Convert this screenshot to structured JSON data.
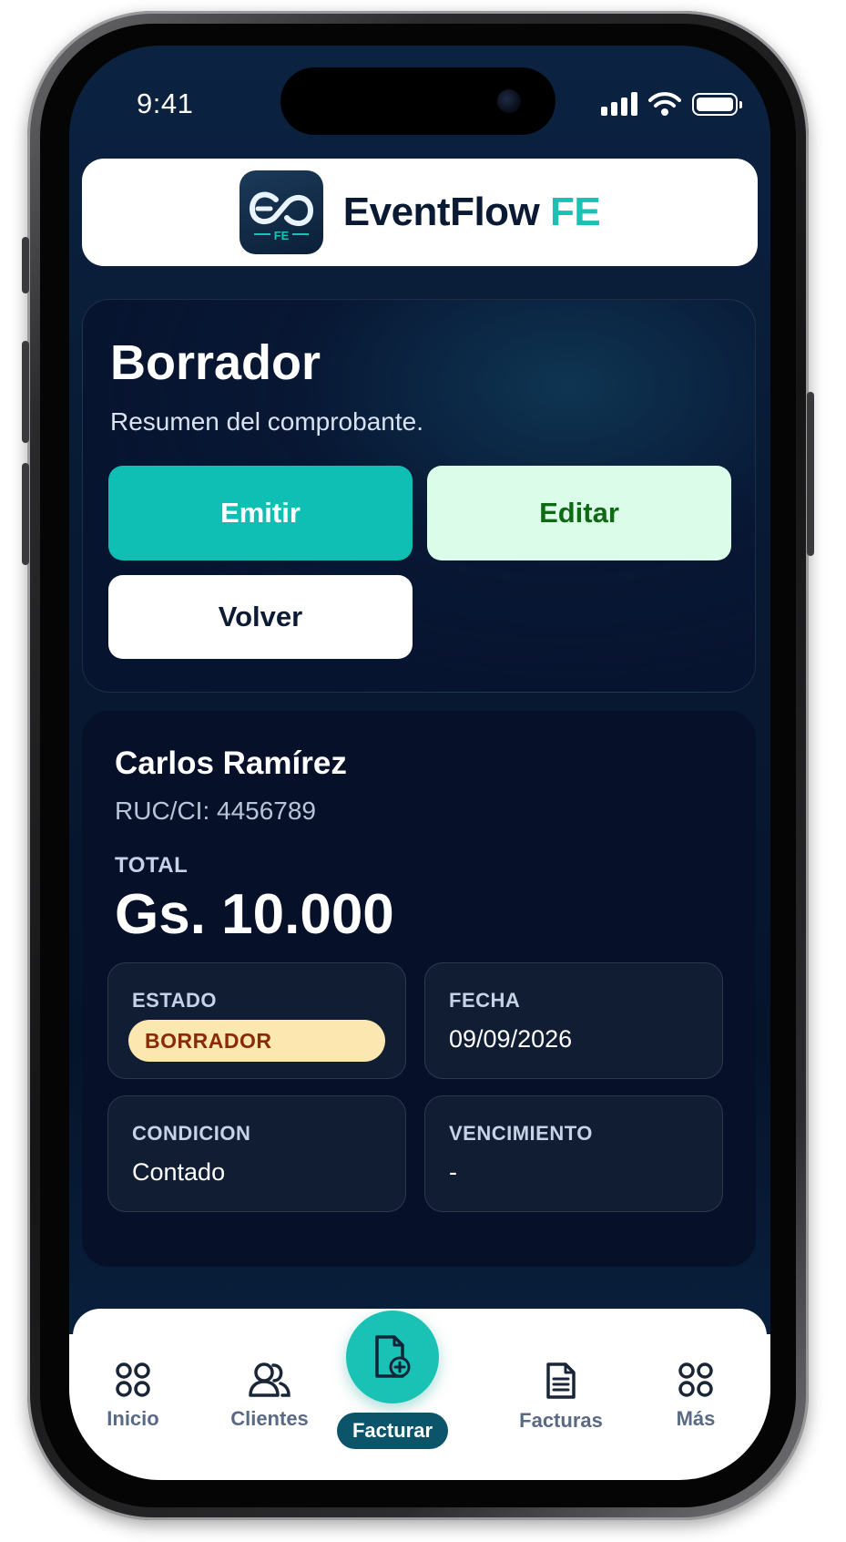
{
  "status_bar": {
    "time": "9:41"
  },
  "brand": {
    "name": "EventFlow",
    "accent": "FE",
    "logo_letters": "FE",
    "accent_color": "#19c2b4"
  },
  "summary": {
    "title": "Borrador",
    "subtitle": "Resumen del comprobante.",
    "buttons": {
      "emit": "Emitir",
      "edit": "Editar",
      "back": "Volver"
    }
  },
  "invoice": {
    "client_name": "Carlos Ramírez",
    "client_id": "RUC/CI: 4456789",
    "total_label": "TOTAL",
    "total_value": "Gs. 10.000",
    "fields": {
      "status_label": "ESTADO",
      "status_value": "BORRADOR",
      "date_label": "FECHA",
      "date_value": "09/09/2026",
      "condition_label": "CONDICION",
      "condition_value": "Contado",
      "due_label": "VENCIMIENTO",
      "due_value": "-"
    }
  },
  "tabs": {
    "home": "Inicio",
    "clients": "Clientes",
    "invoice": "Facturar",
    "invoices": "Facturas",
    "more": "Más"
  },
  "icons": {
    "home": "grid-icon",
    "clients": "users-icon",
    "invoice": "file-plus-icon",
    "invoices": "document-icon",
    "more": "grid-icon"
  }
}
